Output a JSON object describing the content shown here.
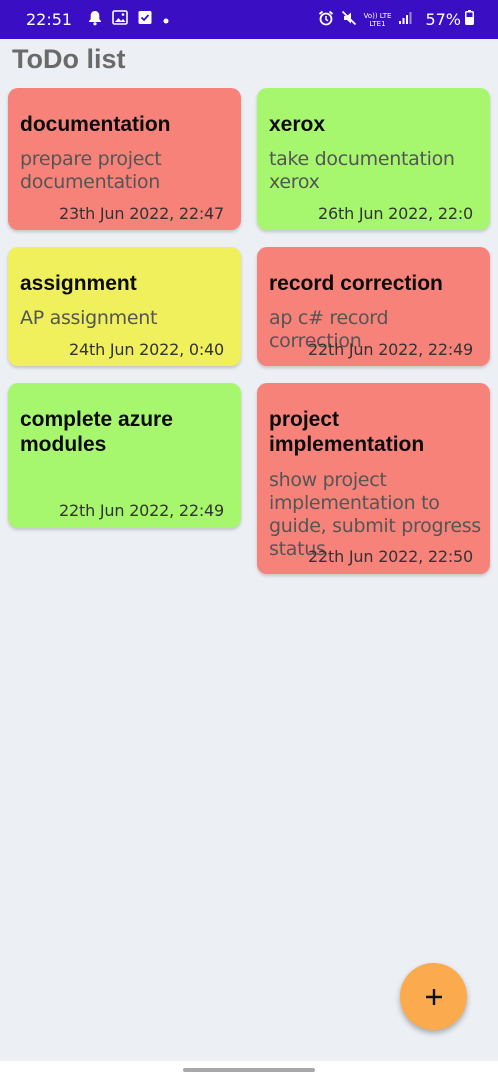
{
  "status_bar": {
    "time": "22:51",
    "left_icons": [
      "bell-icon",
      "image-icon",
      "check-box-icon",
      "dot-icon"
    ],
    "right_icons": [
      "alarm-icon",
      "mute-icon",
      "volte-lte-icon",
      "signal-icon"
    ],
    "volte_label": "Vo)) LTE",
    "lte_sub": "LTE1",
    "battery_percent": "57%",
    "colors": {
      "background": "#3a0fc4",
      "foreground": "#ffffff"
    }
  },
  "header": {
    "title": "ToDo list"
  },
  "notes": [
    {
      "title": "documentation",
      "description": "prepare project documentation",
      "date": "23th Jun 2022, 22:47",
      "color": "#f7827a"
    },
    {
      "title": "xerox",
      "description": "take documentation xerox",
      "date": "26th Jun 2022, 22:0",
      "color": "#a6f76d"
    },
    {
      "title": "assignment",
      "description": "AP assignment",
      "date": "24th Jun 2022, 0:40",
      "color": "#f0ef5c"
    },
    {
      "title": "record correction",
      "description": "ap c# record correction",
      "date": "22th Jun 2022, 22:49",
      "color": "#f7827a"
    },
    {
      "title": "complete azure modules",
      "description": "",
      "date": "22th Jun 2022, 22:49",
      "color": "#a6f76d"
    },
    {
      "title": "project implementation",
      "description": "show project implementation to guide, submit progress status",
      "date": "22th Jun 2022, 22:50",
      "color": "#f7827a"
    }
  ],
  "fab": {
    "icon": "plus-icon",
    "color": "#fbab4e"
  }
}
